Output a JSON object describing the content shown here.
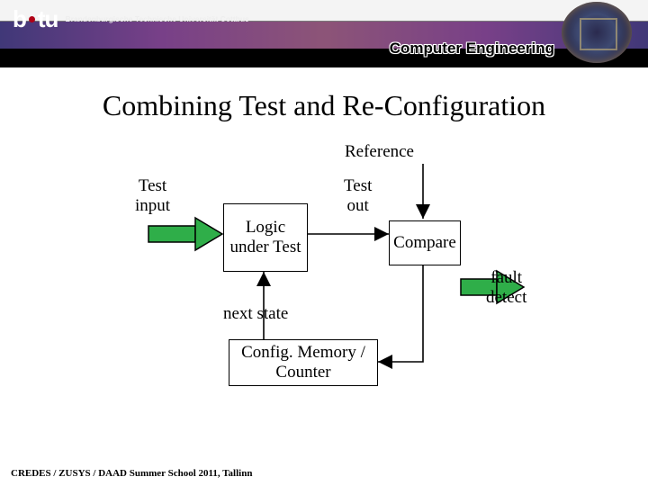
{
  "header": {
    "logo_b": "b",
    "logo_tu": "tu",
    "logo_lines": "Brandenburgische\nTechnische Universität\nCottbus",
    "header_title": "Computer Engineering"
  },
  "slide": {
    "title": "Combining Test and Re-Configuration"
  },
  "labels": {
    "reference": "Reference",
    "test_input": "Test\ninput",
    "test_out": "Test\nout",
    "logic_under_test": "Logic\nunder\nTest",
    "compare": "Compare",
    "fault_detect": "fault\ndetect",
    "next_state": "next state",
    "config_memory": "Config. Memory /\nCounter"
  },
  "footer": {
    "text": "CREDES / ZUSYS / DAAD Summer School 2011, Tallinn"
  },
  "chart_data": {
    "type": "diagram",
    "title": "Combining Test and Re-Configuration",
    "nodes": [
      {
        "id": "test_input",
        "label": "Test input",
        "kind": "source"
      },
      {
        "id": "lut",
        "label": "Logic under Test",
        "kind": "block"
      },
      {
        "id": "reference",
        "label": "Reference",
        "kind": "source"
      },
      {
        "id": "test_out",
        "label": "Test out",
        "kind": "signal"
      },
      {
        "id": "compare",
        "label": "Compare",
        "kind": "block"
      },
      {
        "id": "fault_detect",
        "label": "fault detect",
        "kind": "sink"
      },
      {
        "id": "config_mem",
        "label": "Config. Memory / Counter",
        "kind": "block"
      },
      {
        "id": "next_state",
        "label": "next state",
        "kind": "signal"
      }
    ],
    "edges": [
      {
        "from": "test_input",
        "to": "lut"
      },
      {
        "from": "lut",
        "to": "compare",
        "via": "test_out"
      },
      {
        "from": "reference",
        "to": "compare"
      },
      {
        "from": "compare",
        "to": "fault_detect"
      },
      {
        "from": "compare",
        "to": "config_mem"
      },
      {
        "from": "config_mem",
        "to": "lut",
        "via": "next_state"
      }
    ]
  }
}
